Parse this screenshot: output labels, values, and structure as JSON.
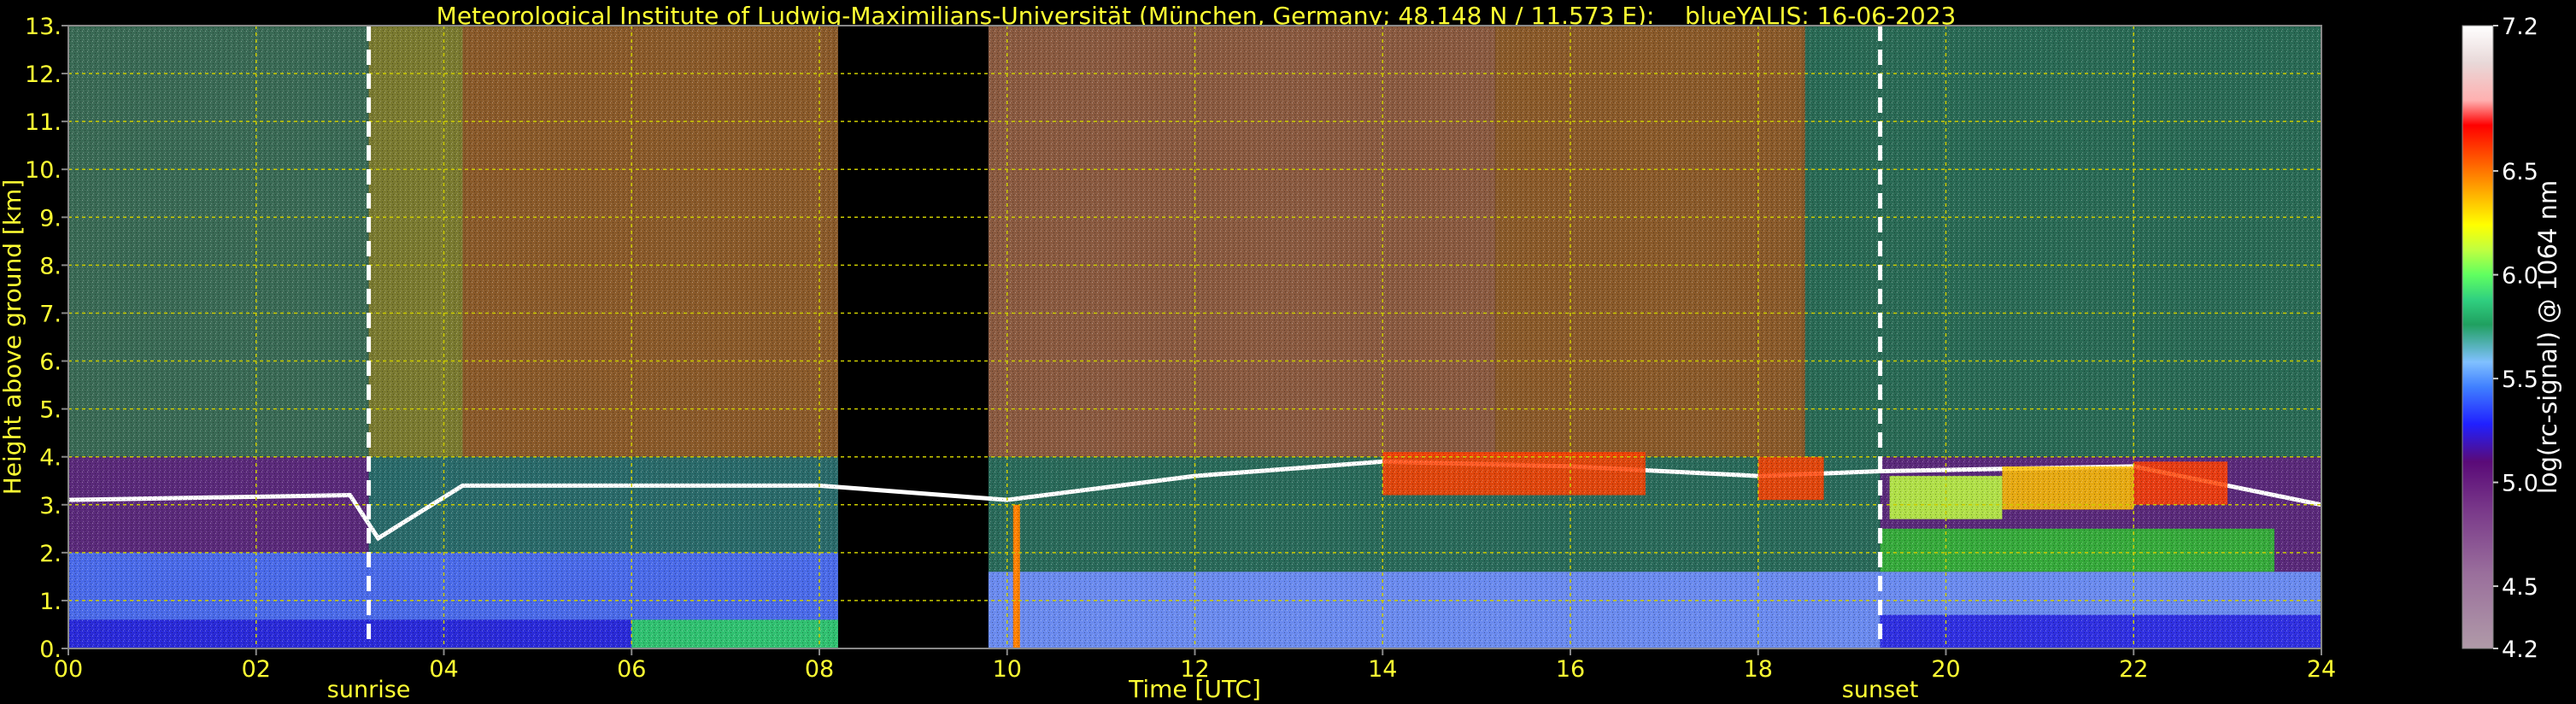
{
  "chart_data": {
    "type": "heatmap",
    "title": "Meteorological Institute of Ludwig-Maximilians-Universität (München, Germany; 48.148 N / 11.573 E):    blueYALIS: 16-06-2023",
    "xlabel": "Time [UTC]",
    "ylabel": "Height above ground [km]",
    "xlim": [
      0,
      24
    ],
    "ylim": [
      0,
      13
    ],
    "x_ticks": [
      "00",
      "02",
      "04",
      "06",
      "08",
      "10",
      "12",
      "14",
      "16",
      "18",
      "20",
      "22",
      "24"
    ],
    "y_ticks": [
      "0.",
      "1.",
      "2.",
      "3.",
      "4.",
      "5.",
      "6.",
      "7.",
      "8.",
      "9.",
      "10.",
      "11.",
      "12.",
      "13."
    ],
    "grid": true,
    "annotations": [
      {
        "label": "sunrise",
        "time": 3.2
      },
      {
        "label": "sunset",
        "time": 19.3
      }
    ],
    "no_data_gaps": [
      [
        8.2,
        9.8
      ]
    ],
    "colorbar": {
      "label": "log(rc-signal) @ 1064 nm",
      "range": [
        4.2,
        7.2
      ],
      "ticks": [
        "7.2",
        "6.5",
        "6.0",
        "5.5",
        "5.0",
        "4.5",
        "4.2"
      ],
      "tick_values": [
        7.2,
        6.5,
        6.0,
        5.5,
        5.0,
        4.5,
        4.2
      ]
    },
    "features": {
      "boundary_layer_top_km": [
        {
          "t": 0.0,
          "h": 3.1
        },
        {
          "t": 3.0,
          "h": 3.2
        },
        {
          "t": 3.3,
          "h": 2.3
        },
        {
          "t": 4.2,
          "h": 3.4
        },
        {
          "t": 8.0,
          "h": 3.4
        },
        {
          "t": 10.0,
          "h": 3.1
        },
        {
          "t": 12.0,
          "h": 3.6
        },
        {
          "t": 14.0,
          "h": 3.9
        },
        {
          "t": 16.0,
          "h": 3.8
        },
        {
          "t": 18.0,
          "h": 3.6
        },
        {
          "t": 19.3,
          "h": 3.7
        },
        {
          "t": 22.0,
          "h": 3.8
        },
        {
          "t": 24.0,
          "h": 3.0
        }
      ],
      "low_cloud_km": [
        {
          "t": 10.1,
          "h": 1.5
        }
      ]
    },
    "palette": [
      "#b09aa8",
      "#9a6f9c",
      "#7a3a8a",
      "#5a0a78",
      "#2020ff",
      "#4080ff",
      "#80c0ff",
      "#20a060",
      "#30d080",
      "#60ff60",
      "#c0ff40",
      "#ffff00",
      "#ffc000",
      "#ff8000",
      "#ff4000",
      "#ff0000",
      "#ffb0b0",
      "#e8d8d8",
      "#ffffff"
    ]
  }
}
